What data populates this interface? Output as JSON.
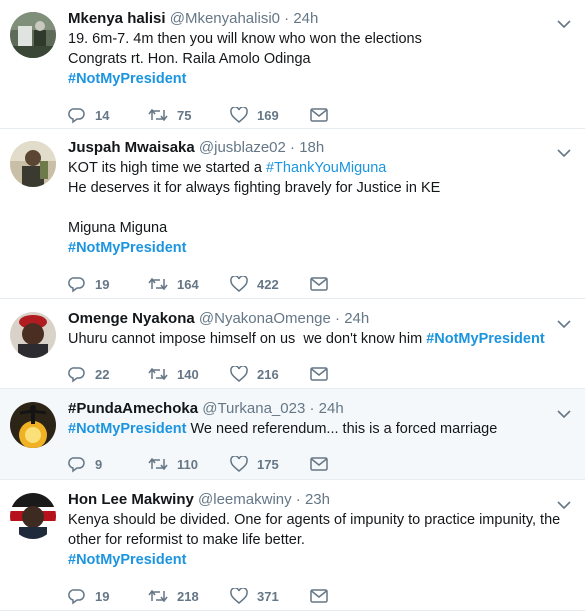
{
  "tweets": [
    {
      "name": "Mkenya halisi",
      "handle": "@Mkenyahalisi0",
      "time": "24h",
      "lines": [
        [
          {
            "t": "19. 6m-7. 4m then you will know who won the elections"
          }
        ],
        [
          {
            "t": "Congrats rt. Hon. Raila Amolo Odinga"
          }
        ],
        [
          {
            "t": "#NotMyPresident",
            "h": true
          }
        ]
      ],
      "replies": "14",
      "retweets": "75",
      "likes": "169"
    },
    {
      "name": "Juspah Mwaisaka",
      "handle": "@jusblaze02",
      "time": "18h",
      "lines": [
        [
          {
            "t": "KOT its high time we started a "
          },
          {
            "t": "#ThankYouMiguna",
            "h": true,
            "n": true
          }
        ],
        [
          {
            "t": "He deserves it for always fighting bravely for Justice in KE"
          }
        ],
        [],
        [
          {
            "t": "Miguna Miguna"
          }
        ],
        [
          {
            "t": "#NotMyPresident",
            "h": true
          }
        ]
      ],
      "replies": "19",
      "retweets": "164",
      "likes": "422"
    },
    {
      "name": "Omenge Nyakona",
      "handle": "@NyakonaOmenge",
      "time": "24h",
      "lines": [
        [
          {
            "t": "Uhuru cannot impose himself on us  we don't know him "
          },
          {
            "t": "#NotMyPresident",
            "h": true
          }
        ]
      ],
      "replies": "22",
      "retweets": "140",
      "likes": "216"
    },
    {
      "name": "#PundaAmechoka",
      "handle": "@Turkana_023",
      "time": "24h",
      "lines": [
        [
          {
            "t": "#NotMyPresident",
            "h": true
          },
          {
            "t": " We need referendum... this is a forced marriage"
          }
        ]
      ],
      "replies": "9",
      "retweets": "110",
      "likes": "175"
    },
    {
      "name": "Hon Lee Makwiny",
      "handle": "@leemakwiny",
      "time": "23h",
      "lines": [
        [
          {
            "t": "Kenya should be divided. One for agents of impunity to practice impunity, the"
          }
        ],
        [
          {
            "t": "other for reformist to make life better."
          }
        ],
        [
          {
            "t": "#NotMyPresident",
            "h": true
          }
        ]
      ],
      "replies": "19",
      "retweets": "218",
      "likes": "371"
    }
  ],
  "icons": {
    "reply": "reply-icon",
    "retweet": "retweet-icon",
    "like": "heart-icon",
    "dm": "envelope-icon",
    "caret": "chevron-down-icon"
  },
  "colors": {
    "hashtag": "#1b95e0",
    "secondary_text": "#657786",
    "divider": "#e6ecf0",
    "highlight_bg": "#f5f8fa"
  }
}
